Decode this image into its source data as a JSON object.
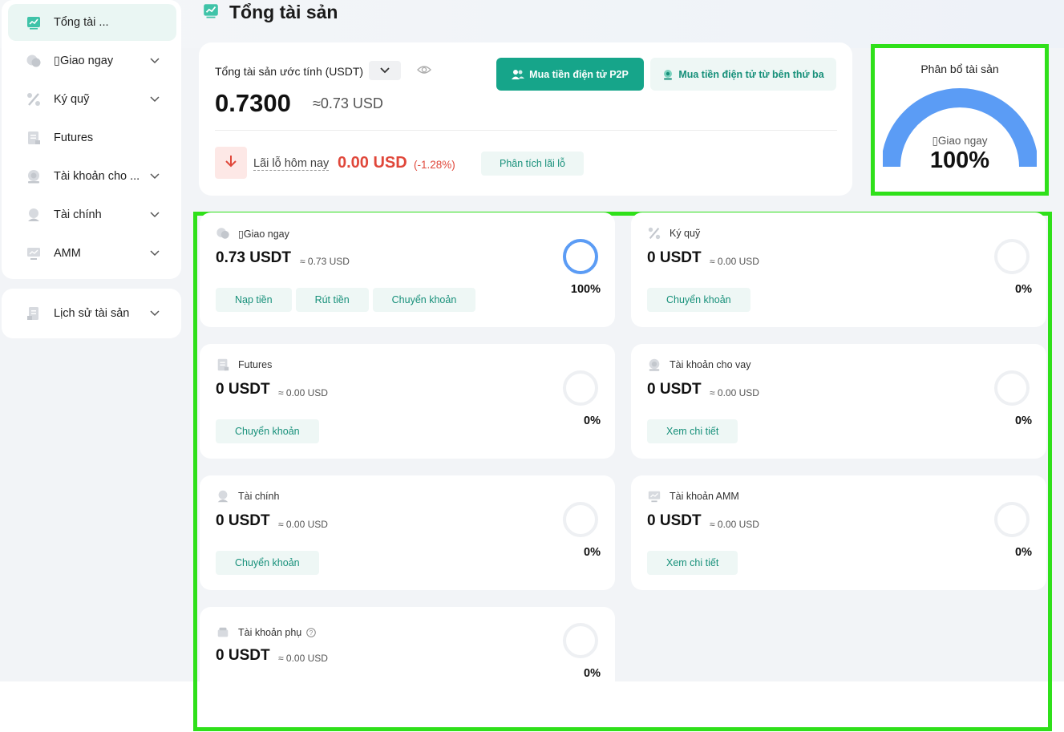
{
  "sidebar": {
    "items": [
      {
        "label": "Tổng tài ...",
        "icon": "chart-icon"
      },
      {
        "label": "▯Giao ngay",
        "icon": "coin-icon"
      },
      {
        "label": "Ký quỹ",
        "icon": "percent-icon"
      },
      {
        "label": "Futures",
        "icon": "document-icon"
      },
      {
        "label": "Tài khoản cho ...",
        "icon": "lending-icon"
      },
      {
        "label": "Tài chính",
        "icon": "finance-icon"
      },
      {
        "label": "AMM",
        "icon": "monitor-icon"
      }
    ],
    "history_label": "Lịch sử tài sản"
  },
  "header": {
    "title": "Tổng tài sản"
  },
  "summary": {
    "estimated_label": "Tổng tài sản ước tính (USDT)",
    "total_value": "0.7300",
    "total_usd": "≈0.73 USD",
    "p2p_button": "Mua tiền điện tử P2P",
    "third_party_button": "Mua tiền điện tử từ bên thứ ba",
    "pnl_label": "Lãi lỗ hôm nay",
    "pnl_value": "0.00 USD",
    "pnl_percent": "(-1.28%)",
    "analysis_button": "Phân tích lãi lỗ"
  },
  "allocation": {
    "title": "Phân bổ tài sản",
    "account": "▯Giao ngay",
    "percent": "100%",
    "fraction": 1.0,
    "color": "#5b9cf5"
  },
  "accounts": [
    {
      "name": "▯Giao ngay",
      "value": "0.73 USDT",
      "usd": "≈ 0.73 USD",
      "percent": "100%",
      "fraction": 1.0,
      "buttons": [
        "Nạp tiền",
        "Rút tiền",
        "Chuyển khoản"
      ]
    },
    {
      "name": "Ký quỹ",
      "value": "0 USDT",
      "usd": "≈ 0.00 USD",
      "percent": "0%",
      "fraction": 0,
      "buttons": [
        "Chuyển khoản"
      ]
    },
    {
      "name": "Futures",
      "value": "0 USDT",
      "usd": "≈ 0.00 USD",
      "percent": "0%",
      "fraction": 0,
      "buttons": [
        "Chuyển khoản"
      ]
    },
    {
      "name": "Tài khoản cho vay",
      "value": "0 USDT",
      "usd": "≈ 0.00 USD",
      "percent": "0%",
      "fraction": 0,
      "buttons": [
        "Xem chi tiết"
      ]
    },
    {
      "name": "Tài chính",
      "value": "0 USDT",
      "usd": "≈ 0.00 USD",
      "percent": "0%",
      "fraction": 0,
      "buttons": [
        "Chuyển khoản"
      ]
    },
    {
      "name": "Tài khoản AMM",
      "value": "0 USDT",
      "usd": "≈ 0.00 USD",
      "percent": "0%",
      "fraction": 0,
      "buttons": [
        "Xem chi tiết"
      ]
    },
    {
      "name": "Tài khoản phụ",
      "value": "0 USDT",
      "usd": "≈ 0.00 USD",
      "percent": "0%",
      "fraction": 0,
      "buttons": []
    }
  ],
  "colors": {
    "accent": "#16a58a",
    "loss": "#e0473a",
    "ring": "#5b9cf5",
    "highlight": "#2fe01a"
  }
}
